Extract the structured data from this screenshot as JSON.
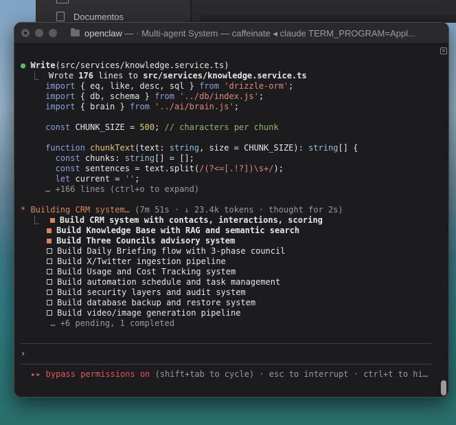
{
  "finder": {
    "sidebar_item": "Documentos"
  },
  "window": {
    "title_bold": "openclaw",
    "title_rest": " — ·  Multi-agent System — caffeinate ◂ claude TERM_PROGRAM=Appl..."
  },
  "write_block": {
    "head_fn": "Write",
    "head_arg": "(src/services/knowledge.service.ts)",
    "summary_pre": "Wrote ",
    "summary_count": "176",
    "summary_mid": " lines to ",
    "summary_path": "src/services/knowledge.service.ts",
    "code": {
      "l1_a": "import",
      "l1_b": " { eq, like, desc, sql } ",
      "l1_c": "from",
      "l1_d": " 'drizzle-orm'",
      "l1_e": ";",
      "l2_a": "import",
      "l2_b": " { db, schema } ",
      "l2_c": "from",
      "l2_d": " '../db/index.js'",
      "l2_e": ";",
      "l3_a": "import",
      "l3_b": " { brain } ",
      "l3_c": "from",
      "l3_d": " '../ai/brain.js'",
      "l3_e": ";",
      "l5_a": "const",
      "l5_b": " CHUNK_SIZE = ",
      "l5_c": "500",
      "l5_d": "; ",
      "l5_e": "// characters per chunk",
      "l7_a": "function",
      "l7_b": " chunkText",
      "l7_c": "(text: ",
      "l7_d": "string",
      "l7_e": ", size = CHUNK_SIZE): ",
      "l7_f": "string",
      "l7_g": "[] {",
      "l8_a": "  const",
      "l8_b": " chunks: ",
      "l8_c": "string",
      "l8_d": "[] = [];",
      "l9_a": "  const",
      "l9_b": " sentences = text.split(",
      "l9_c": "/(?<=[.!?])\\s+/",
      "l9_d": ");",
      "l10_a": "  let",
      "l10_b": " current = ",
      "l10_c": "''",
      "l10_d": ";",
      "more": "… +166 lines (ctrl+o to expand)"
    }
  },
  "status": {
    "spinner": "*",
    "label": " Building CRM system…",
    "meta": " (7m 51s · ↓ 23.4k tokens · thought for 2s)"
  },
  "tasks": [
    {
      "label": "Build CRM system with contacts, interactions, scoring",
      "state": "active"
    },
    {
      "label": "Build Knowledge Base with RAG and semantic search",
      "state": "active"
    },
    {
      "label": "Build Three Councils advisory system",
      "state": "active"
    },
    {
      "label": "Build Daily Briefing flow with 3-phase council",
      "state": "pending"
    },
    {
      "label": "Build X/Twitter ingestion pipeline",
      "state": "pending"
    },
    {
      "label": "Build Usage and Cost Tracking system",
      "state": "pending"
    },
    {
      "label": "Build automation schedule and task management",
      "state": "pending"
    },
    {
      "label": "Build security layers and audit system",
      "state": "pending"
    },
    {
      "label": "Build database backup and restore system",
      "state": "pending"
    },
    {
      "label": "Build video/image generation pipeline",
      "state": "pending"
    }
  ],
  "tasks_more": "… +6 pending, 1 completed",
  "prompt": "›",
  "footer": {
    "arrows": "▸▸",
    "mode": " bypass permissions on",
    "hint": " (shift+tab to cycle) · esc to interrupt · ctrl+t to hi…"
  },
  "colors": {
    "accent_orange": "#d8855a",
    "ok_green": "#4fbf6a",
    "danger_red": "#e2555a",
    "bg": "#1c1c1e"
  }
}
